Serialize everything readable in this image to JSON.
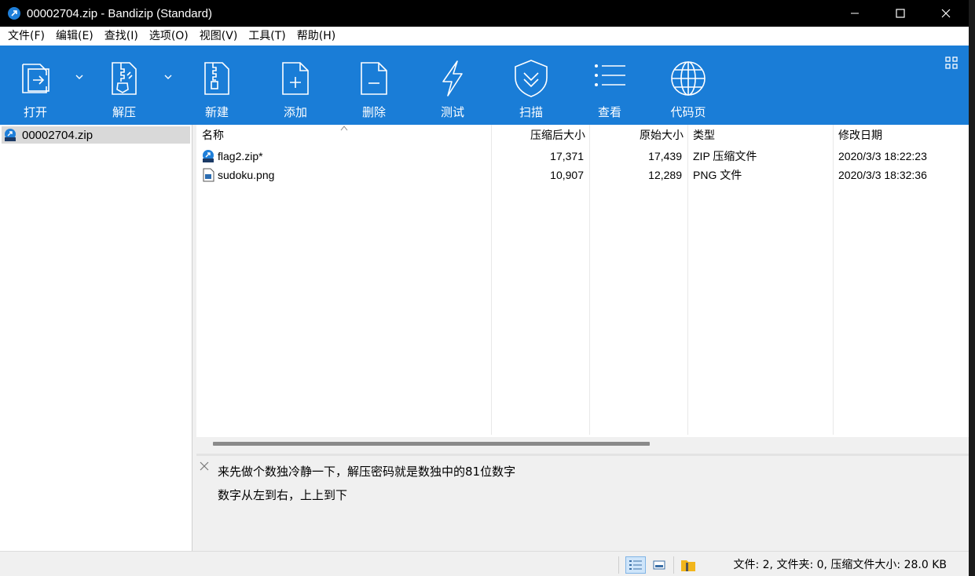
{
  "window": {
    "title": "00002704.zip - Bandizip (Standard)",
    "accent_color": "#1a7dd7",
    "controls": [
      "minimize-icon",
      "maximize-icon",
      "close-icon"
    ]
  },
  "menu": [
    "文件(F)",
    "编辑(E)",
    "查找(I)",
    "选项(O)",
    "视图(V)",
    "工具(T)",
    "帮助(H)"
  ],
  "toolbar": {
    "open": "打开",
    "extract": "解压",
    "new": "新建",
    "add": "添加",
    "delete": "删除",
    "test": "测试",
    "scan": "扫描",
    "view": "查看",
    "codepage": "代码页"
  },
  "tree": {
    "root": "00002704.zip"
  },
  "filelist": {
    "columns": {
      "name": "名称",
      "packed": "压缩后大小",
      "original": "原始大小",
      "type": "类型",
      "modified": "修改日期"
    },
    "rows": [
      {
        "name": "flag2.zip*",
        "packed": "17,371",
        "original": "17,439",
        "type": "ZIP 压缩文件",
        "modified": "2020/3/3 18:22:23",
        "icon": "zip-file-icon"
      },
      {
        "name": "sudoku.png",
        "packed": "10,907",
        "original": "12,289",
        "type": "PNG 文件",
        "modified": "2020/3/3 18:32:36",
        "icon": "image-file-icon"
      }
    ]
  },
  "comment": {
    "line1": "来先做个数独冷静一下，解压密码就是数独中的81位数字",
    "line2": "数字从左到右，上上到下"
  },
  "status": {
    "text": "文件: 2, 文件夹: 0, 压缩文件大小: 28.0 KB"
  }
}
